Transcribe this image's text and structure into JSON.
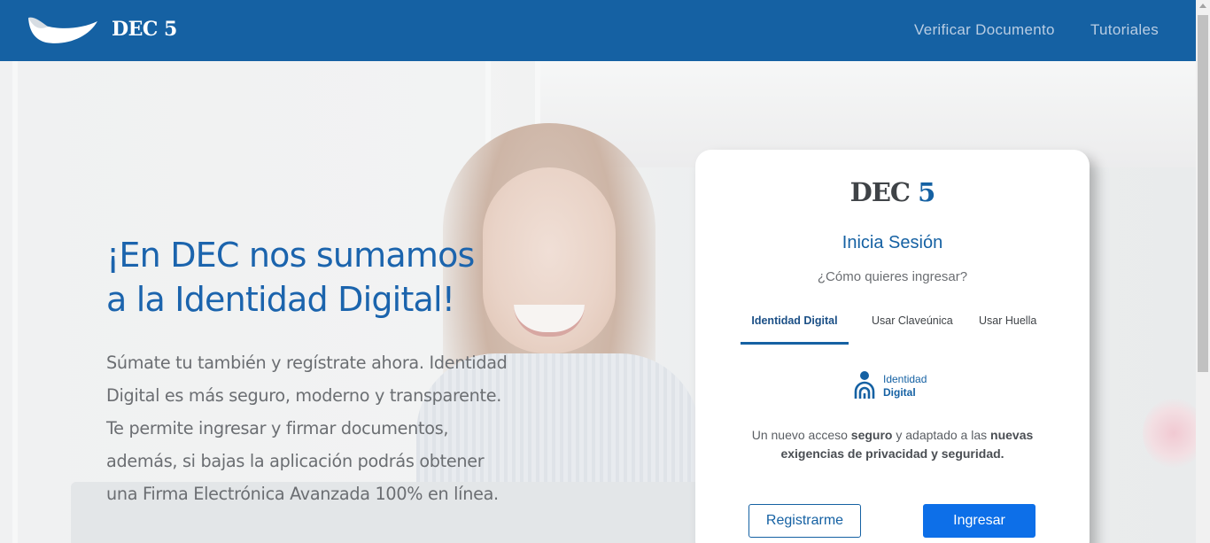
{
  "header": {
    "brand": "DEC 5",
    "nav": {
      "verify": "Verificar Documento",
      "tutorials": "Tutoriales"
    }
  },
  "hero": {
    "headline_line1": "¡En DEC nos sumamos",
    "headline_line2": "a la Identidad Digital!",
    "body_lines": [
      "Súmate tu también y regístrate ahora. Identidad",
      "Digital es más seguro, moderno y transparente.",
      "Te permite ingresar y firmar documentos,",
      "además, si bajas la aplicación podrás obtener",
      "una Firma Electrónica Avanzada 100% en línea."
    ]
  },
  "login": {
    "brand_dec": "DEC",
    "brand_5": "5",
    "title": "Inicia Sesión",
    "question": "¿Cómo quieres ingresar?",
    "tabs": [
      "Identidad Digital",
      "Usar Claveúnica",
      "Usar Huella"
    ],
    "active_tab": "Identidad Digital",
    "identity_label_1": "Identidad",
    "identity_label_2": "Digital",
    "desc_part1": "Un nuevo acceso ",
    "desc_bold1": "seguro",
    "desc_part2": " y adaptado a las ",
    "desc_bold2": "nuevas exigencias de privacidad y seguridad.",
    "register_button": "Registrarme",
    "login_button": "Ingresar"
  },
  "colors": {
    "header_bg": "#1561a3",
    "accent": "#1561a3",
    "primary_button": "#0d6fe8"
  },
  "icons": [
    "dec-logo-icon",
    "identidad-digital-icon",
    "scroll-up-icon"
  ]
}
